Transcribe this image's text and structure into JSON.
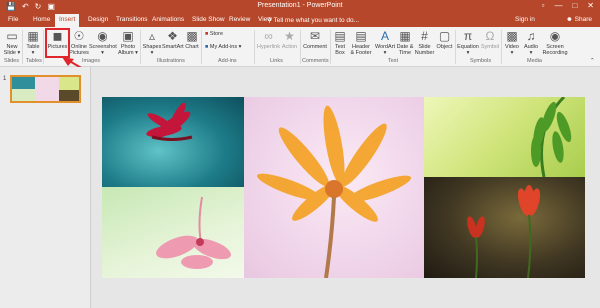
{
  "window": {
    "title": "Presentation1 - PowerPoint"
  },
  "tabs": {
    "file": "File",
    "home": "Home",
    "insert": "Insert",
    "design": "Design",
    "transitions": "Transitions",
    "animations": "Animations",
    "slideshow": "Slide Show",
    "review": "Review",
    "view": "View",
    "tellme": "Tell me what you want to do...",
    "signin": "Sign in",
    "share": "Share"
  },
  "ribbon": {
    "new_slide_line1": "New",
    "new_slide_line2": "Slide",
    "table": "Table",
    "pictures": "Pictures",
    "online_pictures_line1": "Online",
    "online_pictures_line2": "Pictures",
    "screenshot": "Screenshot",
    "photo_album_line1": "Photo",
    "photo_album_line2": "Album",
    "shapes": "Shapes",
    "smartart": "SmartArt",
    "chart": "Chart",
    "store": "Store",
    "my_addins": "My Add-ins",
    "hyperlink": "Hyperlink",
    "action": "Action",
    "comment": "Comment",
    "textbox_line1": "Text",
    "textbox_line2": "Box",
    "header_footer_line1": "Header",
    "header_footer_line2": "& Footer",
    "wordart": "WordArt",
    "date_time_line1": "Date &",
    "date_time_line2": "Time",
    "slide_number_line1": "Slide",
    "slide_number_line2": "Number",
    "object": "Object",
    "equation": "Equation",
    "symbol": "Symbol",
    "video": "Video",
    "audio": "Audio",
    "screen_recording_line1": "Screen",
    "screen_recording_line2": "Recording"
  },
  "groups": {
    "slides": "Slides",
    "tables": "Tables",
    "images": "Images",
    "illustrations": "Illustrations",
    "addins": "Add-ins",
    "links": "Links",
    "comments": "Comments",
    "text": "Text",
    "symbols": "Symbols",
    "media": "Media"
  },
  "thumbnails": {
    "slide_number": "1"
  },
  "colors": {
    "accent": "#b7472a",
    "highlight": "#e0262b",
    "thumb_border": "#e2902b"
  },
  "icons": [
    "save-icon",
    "undo-icon",
    "redo-icon",
    "present-icon",
    "user-icon",
    "share-icon"
  ]
}
